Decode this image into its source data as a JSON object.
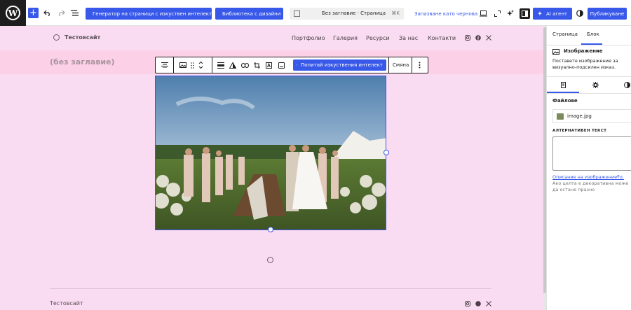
{
  "toolbar": {
    "ai_page_generator": "Генератор на страници с изкуствен интелект",
    "design_library": "Библиотека с дизайни",
    "doc_title": "Без заглавие · Страница",
    "shortcut": "⌘K",
    "save_draft": "Запазване като чернова",
    "ai_agent": "AI агент",
    "publish": "Публикуване"
  },
  "site": {
    "title": "Тестовсайт",
    "nav": [
      "Портфолио",
      "Галерия",
      "Ресурси",
      "За нас",
      "Контакти"
    ],
    "social": [
      "instagram-icon",
      "facebook-icon",
      "x-icon"
    ],
    "page_title_placeholder": "(без заглавие)",
    "footer_title": "Тестовсайт"
  },
  "block_toolbar": {
    "ask_ai": "Попитай изкуствения интелект",
    "replace": "Смяна"
  },
  "sidebar": {
    "tabs": [
      "Страница",
      "Блок"
    ],
    "block_name": "Изображение",
    "block_desc": "Поставете изображение за визуално-подсилен изказ.",
    "files_label": "Файлове",
    "file_name": "image.jpg",
    "alt_label": "АЛТЕРНАТИВЕН ТЕКСТ",
    "alt_value": "",
    "alt_link": "Описание на изображението.",
    "alt_help": "Ако целта е декоративна може да остане празно"
  },
  "colors": {
    "accent": "#3858e9",
    "canvas_bg": "#fadcf2",
    "title_band": "#fcd0e6",
    "sidebar_bg": "#ffffff",
    "dark": "#1e1e1e"
  }
}
